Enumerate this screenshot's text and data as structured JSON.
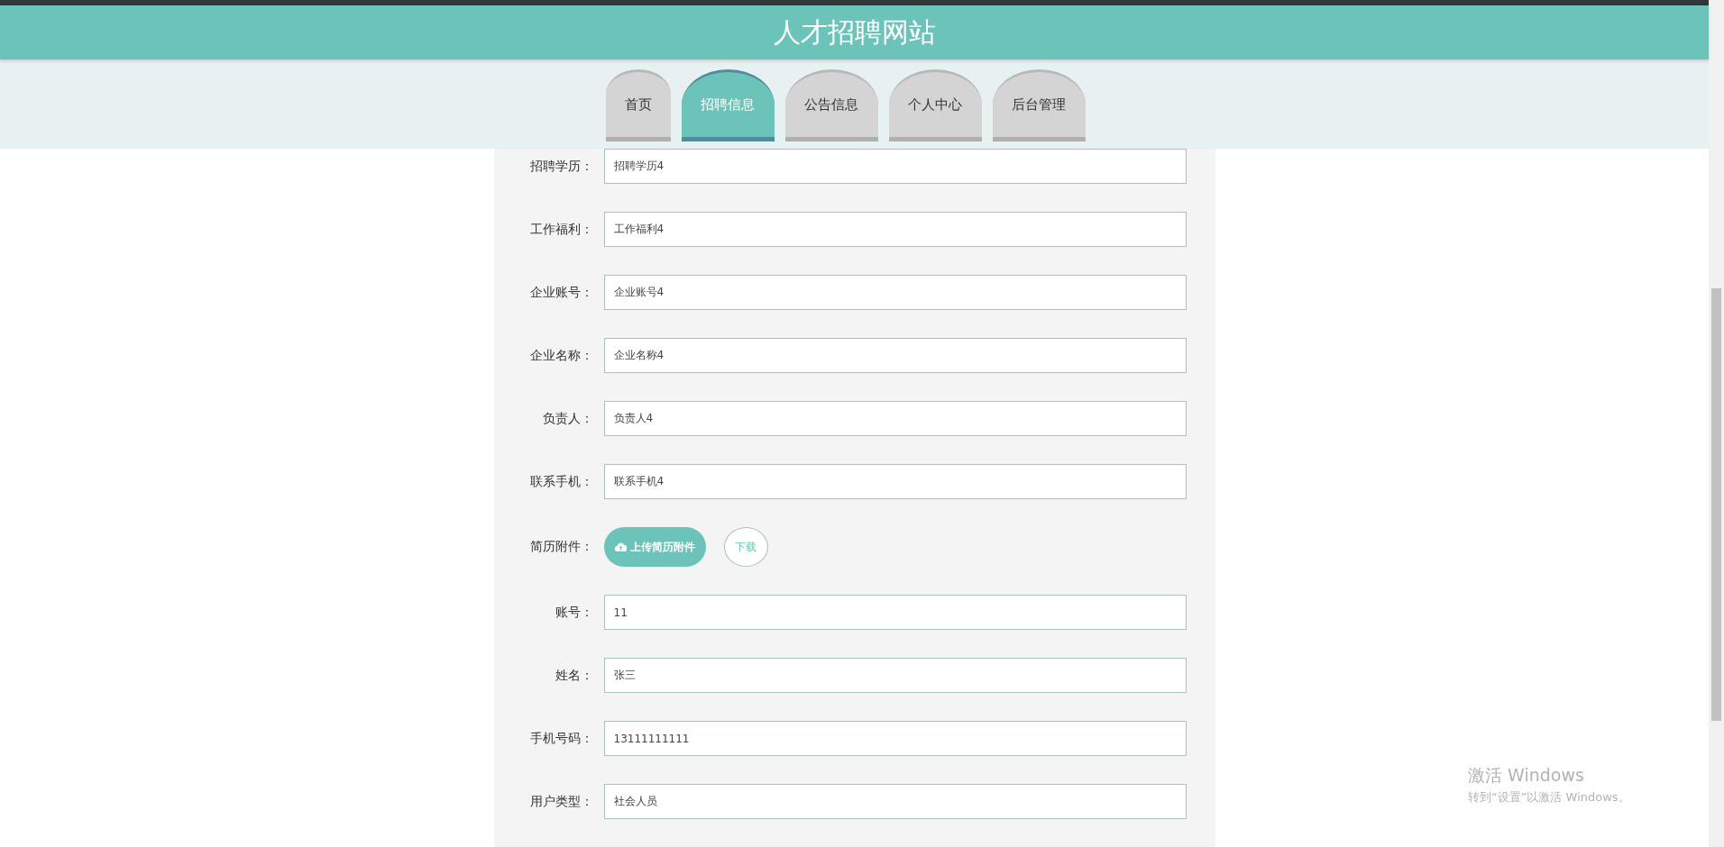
{
  "header": {
    "title": "人才招聘网站"
  },
  "tabs": [
    {
      "label": "首页",
      "selected": false
    },
    {
      "label": "招聘信息",
      "selected": true
    },
    {
      "label": "公告信息",
      "selected": false
    },
    {
      "label": "个人中心",
      "selected": false
    },
    {
      "label": "后台管理",
      "selected": false
    }
  ],
  "form": {
    "rows": [
      {
        "kind": "text",
        "label": "招聘学历：",
        "value": "招聘学历4"
      },
      {
        "kind": "text",
        "label": "工作福利：",
        "value": "工作福利4"
      },
      {
        "kind": "text",
        "label": "企业账号：",
        "value": "企业账号4"
      },
      {
        "kind": "text",
        "label": "企业名称：",
        "value": "企业名称4"
      },
      {
        "kind": "text",
        "label": "负责人：",
        "value": "负责人4"
      },
      {
        "kind": "text",
        "label": "联系手机：",
        "value": "联系手机4"
      },
      {
        "kind": "upload",
        "label": "简历附件：",
        "upload_button": "上传简历附件",
        "download_button": "下载"
      },
      {
        "kind": "text",
        "label": "账号：",
        "value": "11"
      },
      {
        "kind": "text",
        "label": "姓名：",
        "value": "张三"
      },
      {
        "kind": "text",
        "label": "手机号码：",
        "value": "13111111111"
      },
      {
        "kind": "text",
        "label": "用户类型：",
        "value": "社会人员"
      }
    ]
  },
  "activation_notice": {
    "title": "激活 Windows",
    "subtitle": "转到“设置”以激活 Windows。"
  }
}
